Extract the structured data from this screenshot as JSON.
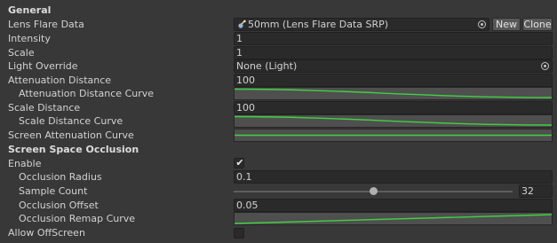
{
  "sections": {
    "general": "General",
    "occlusion": "Screen Space Occlusion"
  },
  "lens_flare_data": {
    "label": "Lens Flare Data",
    "value": "50mm (Lens Flare Data SRP)",
    "new_label": "New",
    "clone_label": "Clone"
  },
  "intensity": {
    "label": "Intensity",
    "value": "1"
  },
  "scale": {
    "label": "Scale",
    "value": "1"
  },
  "light_override": {
    "label": "Light Override",
    "value": "None (Light)"
  },
  "attenuation_distance": {
    "label": "Attenuation Distance",
    "value": "100"
  },
  "attenuation_distance_curve": {
    "label": "Attenuation Distance Curve"
  },
  "scale_distance": {
    "label": "Scale Distance",
    "value": "100"
  },
  "scale_distance_curve": {
    "label": "Scale Distance Curve"
  },
  "screen_attenuation_curve": {
    "label": "Screen Attenuation Curve"
  },
  "enable": {
    "label": "Enable",
    "checked": true
  },
  "occlusion_radius": {
    "label": "Occlusion Radius",
    "value": "0.1"
  },
  "sample_count": {
    "label": "Sample Count",
    "value": "32",
    "fraction": 0.5
  },
  "occlusion_offset": {
    "label": "Occlusion Offset",
    "value": "0.05"
  },
  "occlusion_remap_curve": {
    "label": "Occlusion Remap Curve"
  },
  "allow_offscreen": {
    "label": "Allow OffScreen",
    "checked": false
  },
  "colors": {
    "background": "#383838",
    "field": "#2a2a2a",
    "curve_bg": "#4f4f4f",
    "curve_line": "#3fd13f",
    "button": "#585858"
  },
  "icons": {
    "object_picker": "circle-dot-icon",
    "asset": "lens-flare-asset-icon",
    "checkmark": "checkmark-icon"
  }
}
